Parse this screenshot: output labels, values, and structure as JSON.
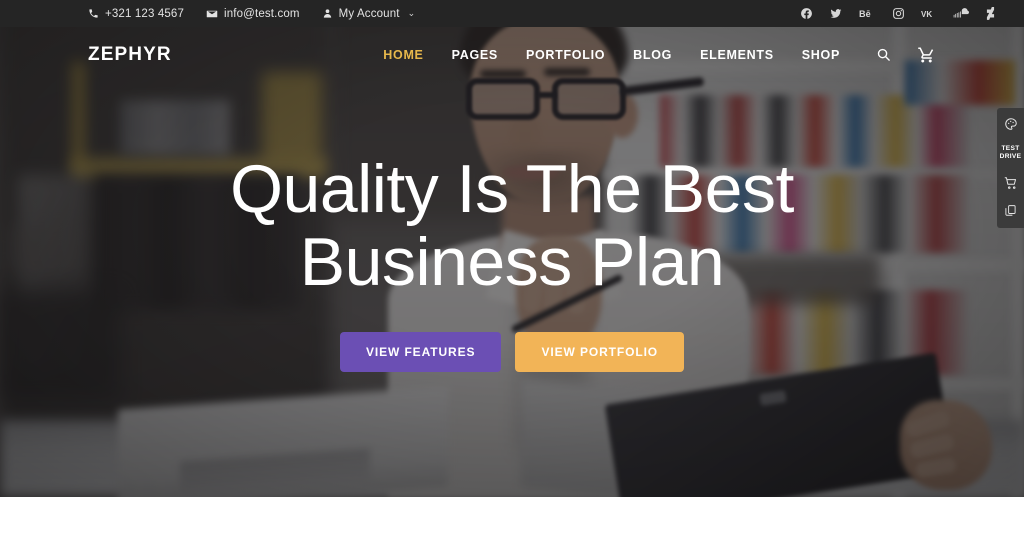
{
  "topbar": {
    "phone": "+321 123 4567",
    "email": "info@test.com",
    "account": "My Account",
    "account_caret": "⌄",
    "social": [
      {
        "name": "facebook",
        "label": "Facebook"
      },
      {
        "name": "twitter",
        "label": "Twitter"
      },
      {
        "name": "behance",
        "label": "Behance"
      },
      {
        "name": "instagram",
        "label": "Instagram"
      },
      {
        "name": "vk",
        "label": "VK"
      },
      {
        "name": "soundcloud",
        "label": "SoundCloud"
      },
      {
        "name": "deviantart",
        "label": "DeviantArt"
      }
    ]
  },
  "header": {
    "logo": "ZEPHYR",
    "nav": [
      {
        "label": "HOME",
        "active": true
      },
      {
        "label": "PAGES",
        "active": false
      },
      {
        "label": "PORTFOLIO",
        "active": false
      },
      {
        "label": "BLOG",
        "active": false
      },
      {
        "label": "ELEMENTS",
        "active": false
      },
      {
        "label": "SHOP",
        "active": false
      }
    ],
    "search_icon": "search-icon",
    "cart_icon": "cart-icon",
    "active_color": "#e8b84b"
  },
  "hero": {
    "title_line1": "Quality Is The Best",
    "title_line2": "Business Plan",
    "primary_button": "VIEW FEATURES",
    "secondary_button": "VIEW PORTFOLIO",
    "primary_color": "#6b4fb4",
    "secondary_color": "#f2b457"
  },
  "rail": {
    "palette_icon": "palette-icon",
    "label_line1": "TEST",
    "label_line2": "DRIVE",
    "cart_icon": "cart-icon",
    "copy_icon": "copy-icon",
    "background": "#3b3b3b"
  }
}
